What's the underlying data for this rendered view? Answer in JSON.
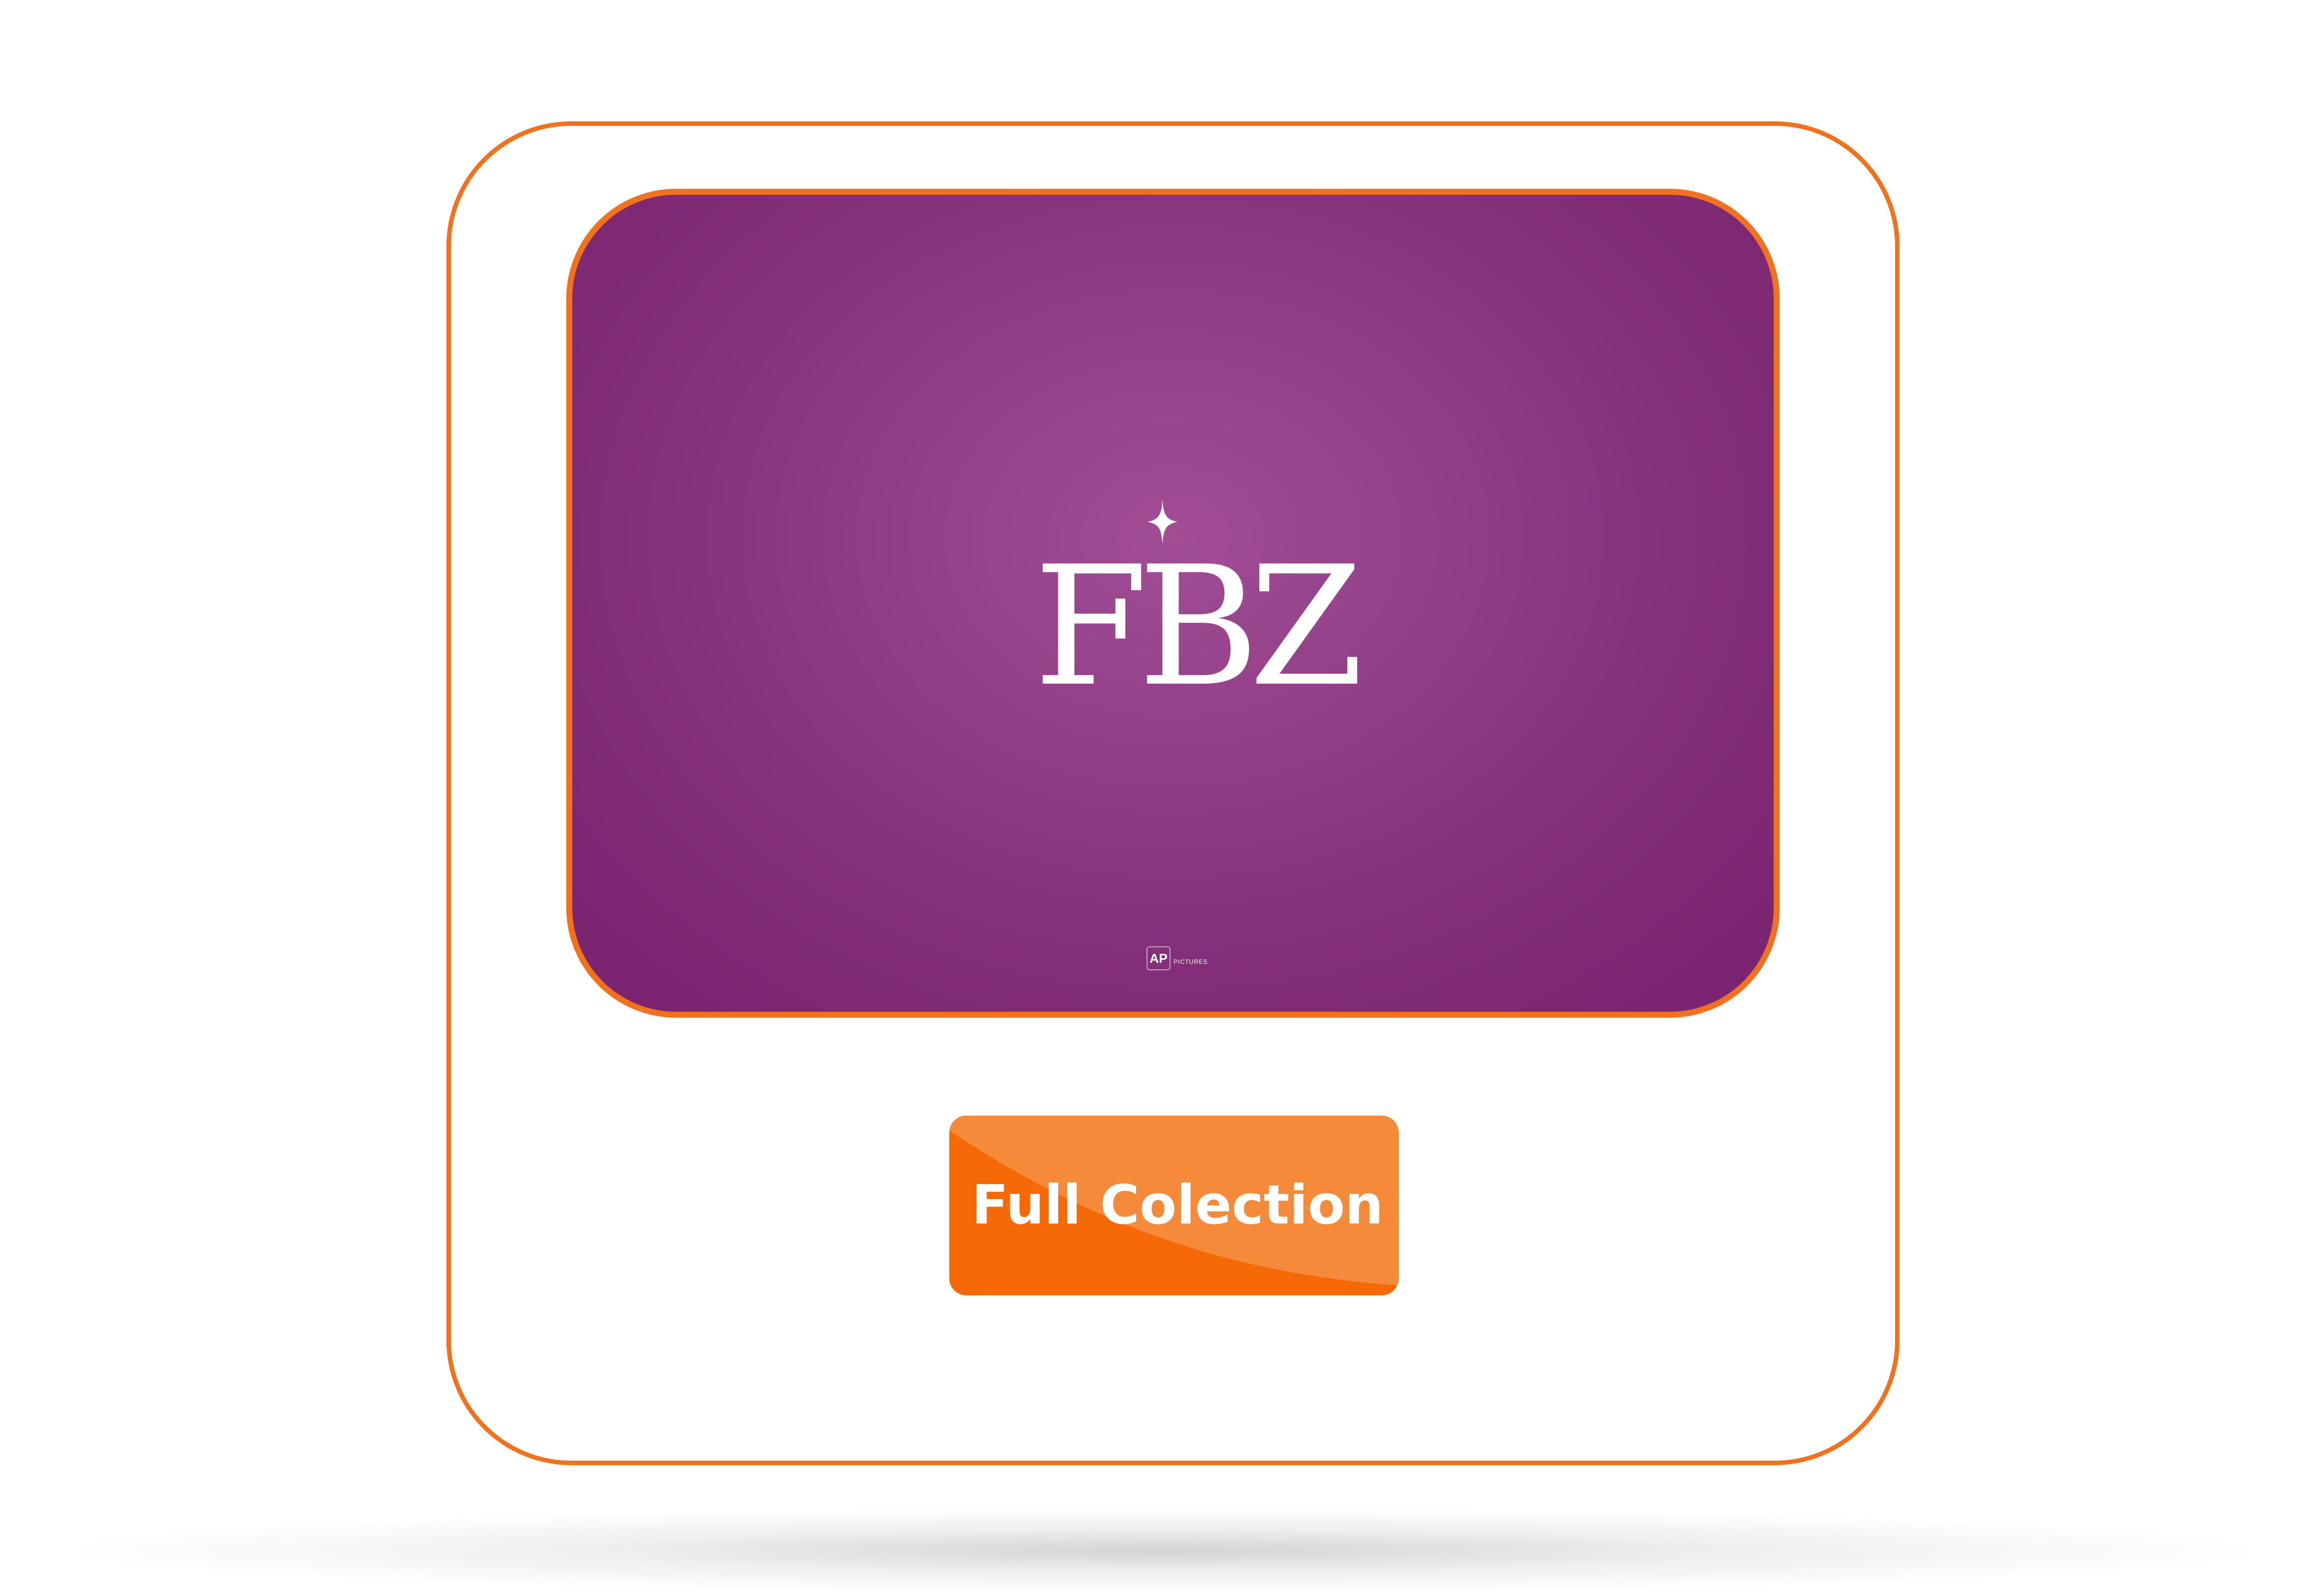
{
  "logo": {
    "text": "FBZ",
    "sparkle_icon": "four-point-star-icon"
  },
  "watermark": {
    "mark": "AP",
    "sub": "PICTURES"
  },
  "cta": {
    "label": "Full Colection"
  },
  "colors": {
    "border_orange": "#f2711c",
    "button_orange": "#f56a07",
    "button_highlight": "#f58a3a",
    "banner_purple_center": "#a24d95",
    "banner_purple_edge": "#792270",
    "text_white": "#ffffff"
  }
}
